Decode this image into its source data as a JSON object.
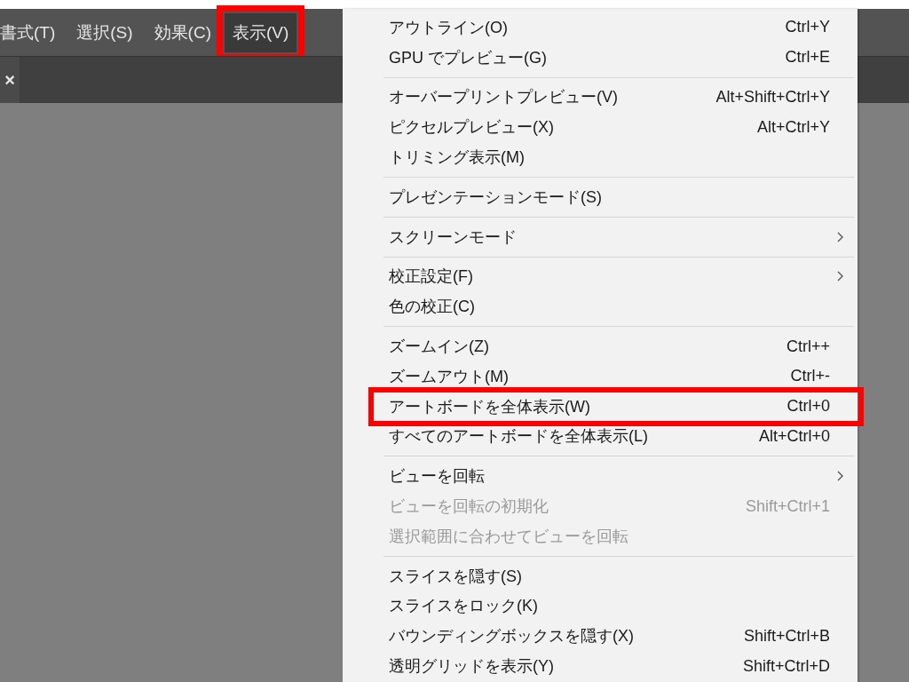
{
  "menubar": [
    {
      "label": "書式(T)",
      "selected": false,
      "highlighted": false
    },
    {
      "label": "選択(S)",
      "selected": false,
      "highlighted": false
    },
    {
      "label": "効果(C)",
      "selected": false,
      "highlighted": false
    },
    {
      "label": "表示(V)",
      "selected": true,
      "highlighted": true
    }
  ],
  "tab": {
    "close": "×"
  },
  "menu": {
    "groups": [
      {
        "items": [
          {
            "label": "アウトライン(O)",
            "shortcut": "Ctrl+Y",
            "submenu": false,
            "disabled": false,
            "highlighted": false
          },
          {
            "label": "GPU でプレビュー(G)",
            "shortcut": "Ctrl+E",
            "submenu": false,
            "disabled": false,
            "highlighted": false
          }
        ]
      },
      {
        "items": [
          {
            "label": "オーバープリントプレビュー(V)",
            "shortcut": "Alt+Shift+Ctrl+Y",
            "submenu": false,
            "disabled": false,
            "highlighted": false
          },
          {
            "label": "ピクセルプレビュー(X)",
            "shortcut": "Alt+Ctrl+Y",
            "submenu": false,
            "disabled": false,
            "highlighted": false
          },
          {
            "label": "トリミング表示(M)",
            "submenu": false,
            "disabled": false,
            "highlighted": false
          }
        ]
      },
      {
        "items": [
          {
            "label": "プレゼンテーションモード(S)",
            "submenu": false,
            "disabled": false,
            "highlighted": false
          }
        ]
      },
      {
        "items": [
          {
            "label": "スクリーンモード",
            "submenu": true,
            "disabled": false,
            "highlighted": false
          }
        ]
      },
      {
        "items": [
          {
            "label": "校正設定(F)",
            "submenu": true,
            "disabled": false,
            "highlighted": false
          },
          {
            "label": "色の校正(C)",
            "submenu": false,
            "disabled": false,
            "highlighted": false
          }
        ]
      },
      {
        "items": [
          {
            "label": "ズームイン(Z)",
            "shortcut": "Ctrl++",
            "submenu": false,
            "disabled": false,
            "highlighted": false
          },
          {
            "label": "ズームアウト(M)",
            "shortcut": "Ctrl+-",
            "submenu": false,
            "disabled": false,
            "highlighted": false
          },
          {
            "label": "アートボードを全体表示(W)",
            "shortcut": "Ctrl+0",
            "submenu": false,
            "disabled": false,
            "highlighted": true
          },
          {
            "label": "すべてのアートボードを全体表示(L)",
            "shortcut": "Alt+Ctrl+0",
            "submenu": false,
            "disabled": false,
            "highlighted": false
          }
        ]
      },
      {
        "items": [
          {
            "label": "ビューを回転",
            "submenu": true,
            "disabled": false,
            "highlighted": false
          },
          {
            "label": "ビューを回転の初期化",
            "shortcut": "Shift+Ctrl+1",
            "submenu": false,
            "disabled": true,
            "highlighted": false
          },
          {
            "label": "選択範囲に合わせてビューを回転",
            "submenu": false,
            "disabled": true,
            "highlighted": false
          }
        ]
      },
      {
        "items": [
          {
            "label": "スライスを隠す(S)",
            "submenu": false,
            "disabled": false,
            "highlighted": false
          },
          {
            "label": "スライスをロック(K)",
            "submenu": false,
            "disabled": false,
            "highlighted": false
          },
          {
            "label": "バウンディングボックスを隠す(X)",
            "shortcut": "Shift+Ctrl+B",
            "submenu": false,
            "disabled": false,
            "highlighted": false
          },
          {
            "label": "透明グリッドを表示(Y)",
            "shortcut": "Shift+Ctrl+D",
            "submenu": false,
            "disabled": false,
            "highlighted": false
          }
        ]
      }
    ]
  }
}
